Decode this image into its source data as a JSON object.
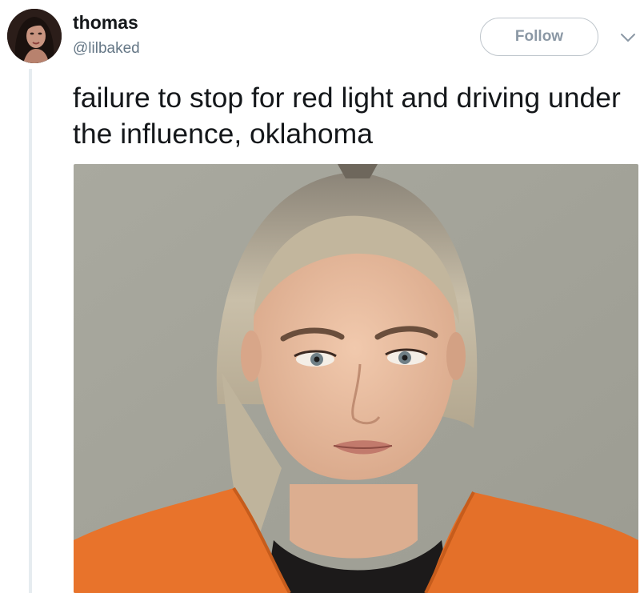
{
  "tweet": {
    "author": {
      "display_name": "thomas",
      "handle": "@lilbaked",
      "avatar_icon": "profile-photo"
    },
    "follow_label": "Follow",
    "menu_icon": "chevron-down-icon",
    "text": "failure to stop for red light and driving under the influence, oklahoma",
    "media": {
      "kind": "photo",
      "icon": "mugshot-photo"
    }
  },
  "colors": {
    "text_primary": "#14171a",
    "text_secondary": "#657786",
    "follow_border": "#bfc6cc",
    "thread_line": "#e6ecf0",
    "photo_background": "#a8a89e",
    "jumpsuit": "#e8732b"
  }
}
